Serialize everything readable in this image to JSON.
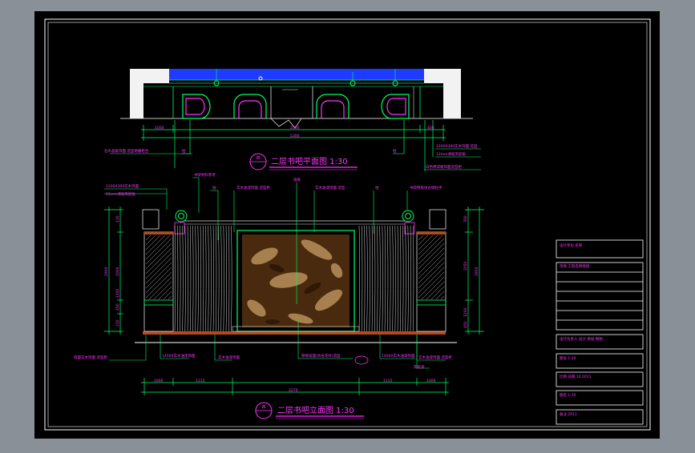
{
  "drawing": {
    "plan_title": "二层书吧平面图  1:30",
    "plan_tag": "四",
    "elev_title": "二层书吧立面图  1:30",
    "elev_tag": "四",
    "colors": {
      "background": "#8a9097",
      "canvas": "#000000",
      "frame": "#ffffff",
      "dimension": "#00ff66",
      "annotation": "#ff33ff",
      "title": "#ff33ff",
      "wall_fill": "#f4f4f4",
      "glass": "#1e3cff",
      "panel": "#4a2a0e"
    }
  },
  "plan_dims": {
    "top": [
      "1000",
      "2500",
      "400"
    ],
    "bottom": "5300"
  },
  "plan_notes": {
    "left": [
      "石水晶板饰面 造型格栅柜台"
    ],
    "mid": [
      "柱"
    ],
    "right": [
      "1200X300实木饰面 造型",
      "12mm清玻夹胶板",
      "白色烤漆板饰面造型柜"
    ]
  },
  "elev_notes": {
    "top": [
      "1200X300实木饰面",
      "12mm清玻夹胶板",
      "书架材料参考",
      "柱",
      "实木油漆饰面 造型柜",
      "墙纸",
      "实木油漆饰面 造型",
      "柱",
      "书架壁纸仿古铜拉手"
    ],
    "bottom": [
      "墙面实木饰面 造型柜",
      "1400X实木油漆饰面",
      "实木油漆饰面",
      "壁纸墙面(仿古花纹)造型",
      "1400X实木油漆饰面",
      "实木油漆饰面 造型柜",
      "乳胶漆"
    ]
  },
  "elev_dims": {
    "bottom": [
      "1000",
      "1115",
      "2270",
      "1115",
      "1000"
    ],
    "left": [
      "130",
      "1000",
      "1190",
      "2900",
      "450",
      "210"
    ],
    "right": [
      "350",
      "2050",
      "1200",
      "2900",
      "450"
    ]
  },
  "title_block": [
    "设计单位 名称",
    "项目 工程名称图纸",
    "",
    "",
    "",
    "",
    "",
    "设计负责人  设计 审核 制图",
    "图号  1:30",
    "比例 日期   10   2011",
    "图名  1:30",
    "备注   2011"
  ]
}
